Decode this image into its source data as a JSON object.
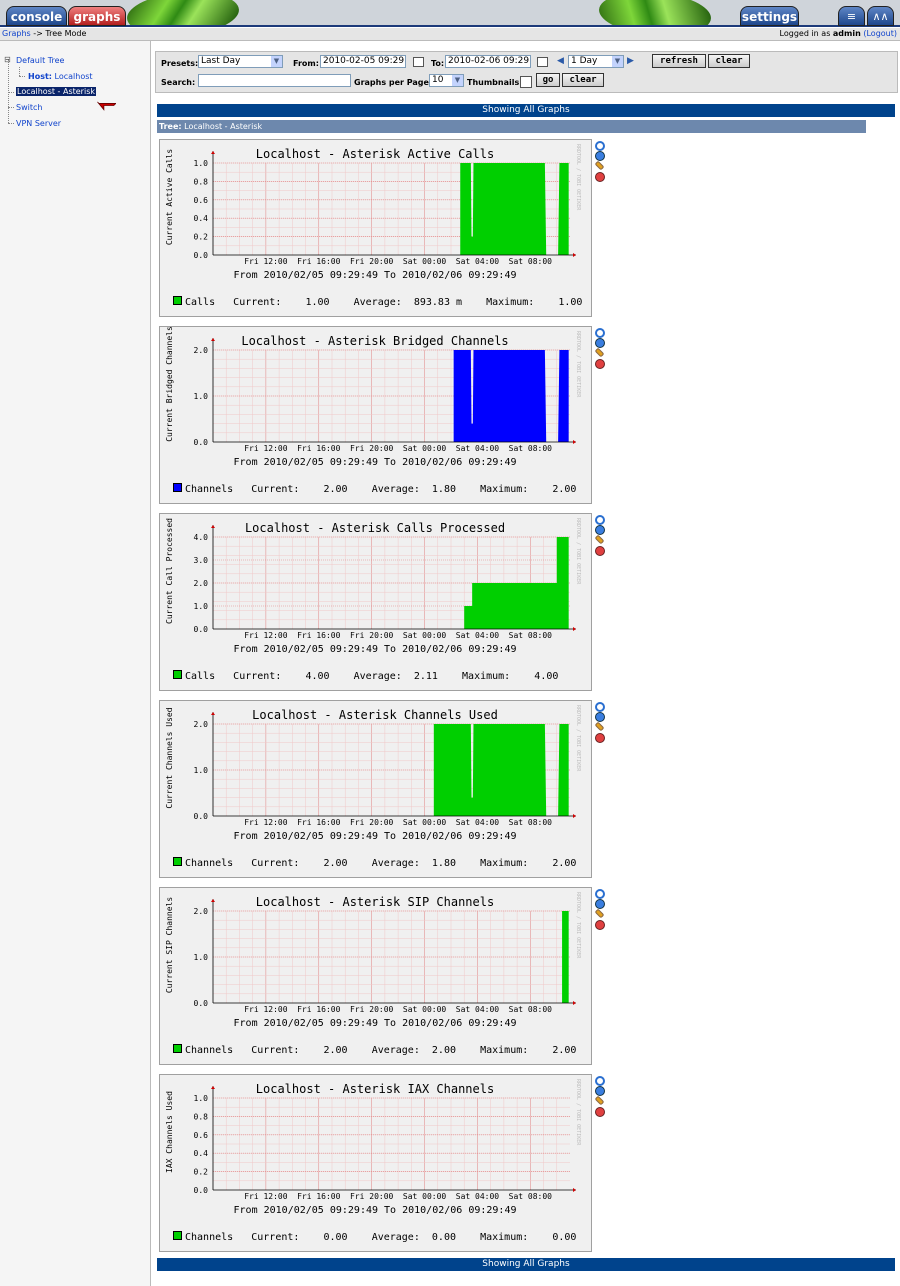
{
  "header": {
    "tabs": {
      "console": "console",
      "graphs": "graphs",
      "settings": "settings"
    },
    "icons": [
      "tree-view-icon",
      "list-view-icon",
      "preview-view-icon"
    ]
  },
  "breadcrumb": {
    "link": "Graphs",
    "separator": " -> ",
    "current": "Tree Mode"
  },
  "login": {
    "prefix": "Logged in as ",
    "user": "admin",
    "logout": "(Logout)"
  },
  "tree": {
    "root": "Default Tree",
    "host_label": "Host:",
    "host_value": "Localhost",
    "items": [
      "Localhost - Asterisk",
      "Switch",
      "VPN Server"
    ],
    "selected_index": 0
  },
  "filters": {
    "presets_label": "Presets:",
    "presets_value": "Last Day",
    "from_label": "From:",
    "from_value": "2010-02-05 09:29",
    "to_label": "To:",
    "to_value": "2010-02-06 09:29",
    "timespan_value": "1 Day",
    "refresh": "refresh",
    "clear": "clear",
    "search_label": "Search:",
    "search_value": "",
    "per_page_label": "Graphs per Page:",
    "per_page_value": "10",
    "thumbnails_label": "Thumbnails:",
    "thumbnails_checked": false,
    "go": "go",
    "clear2": "clear"
  },
  "showing_all": "Showing All Graphs",
  "tree_header": {
    "label": "Tree:",
    "value": "Localhost - Asterisk"
  },
  "rrd_watermark": "RRDTOOL / TOBI OETIKER",
  "range_text": "From 2010/02/05 09:29:49 To 2010/02/06 09:29:49",
  "x_ticks": [
    "Fri 12:00",
    "Fri 16:00",
    "Fri 20:00",
    "Sat 00:00",
    "Sat 04:00",
    "Sat 08:00"
  ],
  "graph_icons": [
    "zoom-icon",
    "view-icon",
    "edit-icon",
    "delete-icon"
  ],
  "chart_data": [
    {
      "type": "area",
      "title": "Localhost - Asterisk Active Calls",
      "ylabel": "Current Active Calls",
      "ylim": [
        0,
        1.0
      ],
      "yticks": [
        "0.0",
        "0.2",
        "0.4",
        "0.6",
        "0.8",
        "1.0"
      ],
      "yvals": [
        0,
        0.2,
        0.4,
        0.6,
        0.8,
        1.0
      ],
      "color": "#00CF00",
      "x_hours": [
        0,
        18.7,
        18.7,
        19.5,
        19.55,
        19.65,
        19.7,
        25.1,
        25.2,
        26.1,
        26.2,
        26.9
      ],
      "series": [
        {
          "name": "Calls",
          "values": [
            0,
            0,
            1,
            1,
            0.2,
            0.2,
            1,
            1,
            0,
            0,
            1,
            1
          ]
        }
      ],
      "legend": {
        "name": "Calls",
        "current_label": "Current:",
        "current": "1.00",
        "average_label": "Average:",
        "average": "893.83 m",
        "maximum_label": "Maximum:",
        "maximum": "1.00"
      }
    },
    {
      "type": "area",
      "title": "Localhost - Asterisk Bridged Channels",
      "ylabel": "Current Bridged Channels",
      "ylim": [
        0,
        2.0
      ],
      "yticks": [
        "0.0",
        "1.0",
        "2.0"
      ],
      "yvals": [
        0,
        1,
        2
      ],
      "color": "#0000FF",
      "x_hours": [
        0,
        18.2,
        18.2,
        19.5,
        19.55,
        19.65,
        19.7,
        25.1,
        25.2,
        26.1,
        26.2,
        26.9
      ],
      "series": [
        {
          "name": "Channels",
          "values": [
            0,
            0,
            2,
            2,
            0.4,
            0.4,
            2,
            2,
            0,
            0,
            2,
            2
          ]
        }
      ],
      "legend": {
        "name": "Channels",
        "current_label": "Current:",
        "current": "2.00",
        "average_label": "Average:",
        "average": "1.80",
        "maximum_label": "Maximum:",
        "maximum": "2.00"
      }
    },
    {
      "type": "area",
      "title": "Localhost - Asterisk Calls Processed",
      "ylabel": "Current Call Processed",
      "ylim": [
        0,
        4.0
      ],
      "yticks": [
        "0.0",
        "1.0",
        "2.0",
        "3.0",
        "4.0"
      ],
      "yvals": [
        0,
        1,
        2,
        3,
        4
      ],
      "color": "#00CF00",
      "x_hours": [
        0,
        19.0,
        19.0,
        19.6,
        19.6,
        26.0,
        26.0,
        26.9
      ],
      "series": [
        {
          "name": "Calls",
          "values": [
            0,
            0,
            1,
            1,
            2,
            2,
            4,
            4
          ]
        }
      ],
      "legend": {
        "name": "Calls",
        "current_label": "Current:",
        "current": "4.00",
        "average_label": "Average:",
        "average": "2.11",
        "maximum_label": "Maximum:",
        "maximum": "4.00"
      }
    },
    {
      "type": "area",
      "title": "Localhost - Asterisk Channels Used",
      "ylabel": "Current Channels Used",
      "ylim": [
        0,
        2.0
      ],
      "yticks": [
        "0.0",
        "1.0",
        "2.0"
      ],
      "yvals": [
        0,
        1,
        2
      ],
      "color": "#00CF00",
      "x_hours": [
        0,
        16.7,
        16.7,
        19.5,
        19.55,
        19.65,
        19.7,
        25.1,
        25.2,
        26.1,
        26.2,
        26.9
      ],
      "series": [
        {
          "name": "Channels",
          "values": [
            0,
            0,
            2,
            2,
            0.4,
            0.4,
            2,
            2,
            0,
            0,
            2,
            2
          ]
        }
      ],
      "legend": {
        "name": "Channels",
        "current_label": "Current:",
        "current": "2.00",
        "average_label": "Average:",
        "average": "1.80",
        "maximum_label": "Maximum:",
        "maximum": "2.00"
      }
    },
    {
      "type": "area",
      "title": "Localhost - Asterisk SIP Channels",
      "ylabel": "Current SIP Channels",
      "ylim": [
        0,
        2.0
      ],
      "yticks": [
        "0.0",
        "1.0",
        "2.0"
      ],
      "yvals": [
        0,
        1,
        2
      ],
      "color": "#00CF00",
      "x_hours": [
        0,
        26.4,
        26.4,
        26.9
      ],
      "series": [
        {
          "name": "Channels",
          "values": [
            0,
            0,
            2,
            2
          ]
        }
      ],
      "legend": {
        "name": "Channels",
        "current_label": "Current:",
        "current": "2.00",
        "average_label": "Average:",
        "average": "2.00",
        "maximum_label": "Maximum:",
        "maximum": "2.00"
      }
    },
    {
      "type": "area",
      "title": "Localhost - Asterisk IAX Channels",
      "ylabel": "IAX Channels Used",
      "ylim": [
        0,
        1.0
      ],
      "yticks": [
        "0.0",
        "0.2",
        "0.4",
        "0.6",
        "0.8",
        "1.0"
      ],
      "yvals": [
        0,
        0.2,
        0.4,
        0.6,
        0.8,
        1.0
      ],
      "color": "#00CF00",
      "x_hours": [
        0,
        26.9
      ],
      "series": [
        {
          "name": "Channels",
          "values": [
            0,
            0
          ]
        }
      ],
      "legend": {
        "name": "Channels",
        "current_label": "Current:",
        "current": "0.00",
        "average_label": "Average:",
        "average": "0.00",
        "maximum_label": "Maximum:",
        "maximum": "0.00"
      }
    }
  ]
}
